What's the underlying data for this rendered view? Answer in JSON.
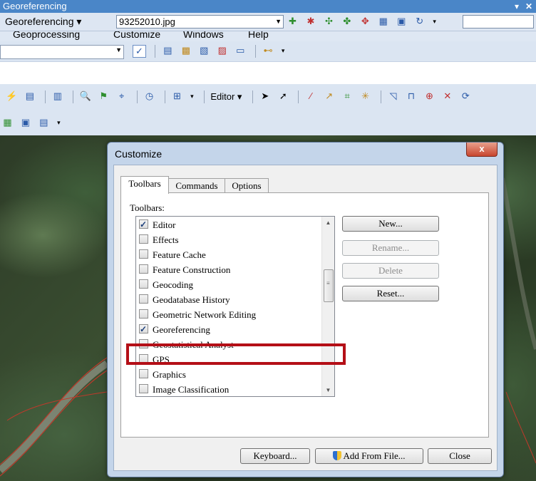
{
  "geo_toolbar": {
    "title": "Georeferencing",
    "menu_label": "Georeferencing",
    "menu_underline": "G",
    "layer_value": "93252010.jpg"
  },
  "menubar": {
    "items": [
      "Geoprocessing",
      "Customize",
      "Windows",
      "Help"
    ]
  },
  "toolbar": {
    "editor_label": "Editor"
  },
  "dialog": {
    "title": "Customize",
    "close_label": "x",
    "tabs": [
      "Toolbars",
      "Commands",
      "Options"
    ],
    "list_label": "Toolbars:",
    "toolbars": [
      {
        "label": "Editor",
        "checked": true
      },
      {
        "label": "Effects",
        "checked": false
      },
      {
        "label": "Feature Cache",
        "checked": false
      },
      {
        "label": "Feature Construction",
        "checked": false
      },
      {
        "label": "Geocoding",
        "checked": false
      },
      {
        "label": "Geodatabase History",
        "checked": false
      },
      {
        "label": "Geometric Network Editing",
        "checked": false
      },
      {
        "label": "Georeferencing",
        "checked": true
      },
      {
        "label": "Geostatistical Analyst",
        "checked": false
      },
      {
        "label": "GPS",
        "checked": false
      },
      {
        "label": "Graphics",
        "checked": false
      },
      {
        "label": "Image Classification",
        "checked": false
      }
    ],
    "side_buttons": {
      "new": "New...",
      "rename": "Rename...",
      "delete": "Delete",
      "reset": "Reset..."
    },
    "bottom_buttons": {
      "keyboard": "Keyboard...",
      "add_from_file": "Add From File...",
      "close": "Close"
    }
  },
  "colors": {
    "title_bar": "#4a86c8",
    "highlight_box": "#b40f17",
    "dialog_frame": "#c4d5ea"
  }
}
